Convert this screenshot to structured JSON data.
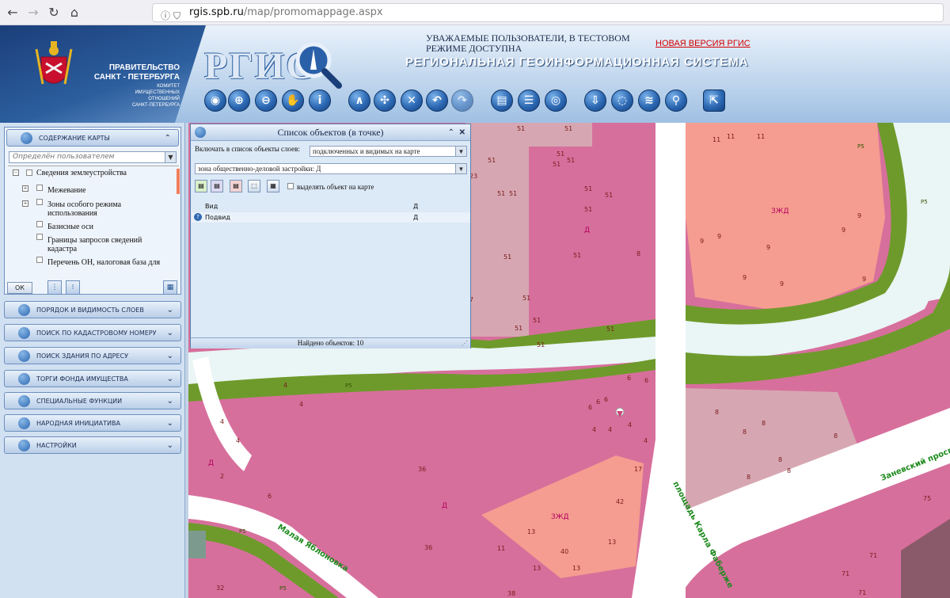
{
  "browser": {
    "url_host": "rgis.spb.ru",
    "url_path": "/map/promomappage.aspx"
  },
  "header": {
    "govt_line1": "ПРАВИТЕЛЬСТВО",
    "govt_line2": "САНКТ - ПЕТЕРБУРГА",
    "committee": [
      "КОМИТЕТ",
      "ИМУЩЕСТВЕННЫХ",
      "ОТНОШЕНИЙ",
      "САНКТ-ПЕТЕРБУРГА"
    ],
    "logo_text": "РГИС",
    "notice": "УВАЖАЕМЫЕ ПОЛЬЗОВАТЕЛИ, В ТЕСТОВОМ РЕЖИМЕ ДОСТУПНА",
    "new_version_link": "НОВАЯ ВЕРСИЯ РГИС",
    "system_title": "РЕГИОНАЛЬНАЯ  ГЕОИНФОРМАЦИОННАЯ СИСТЕМА",
    "toolbar_icons": [
      "globe-icon",
      "zoom-in-icon",
      "zoom-out-icon",
      "pan-hand-icon",
      "info-icon",
      "measure-compass-icon",
      "center-icon",
      "clear-icon",
      "back-icon",
      "forward-icon",
      "print-icon",
      "list-icon",
      "globe-refresh-icon",
      "download-icon",
      "comment-icon",
      "rss-icon",
      "location-pin-icon",
      "export-icon"
    ]
  },
  "sidebar": {
    "content_panel": {
      "title": "СОДЕРЖАНИЕ КАРТЫ",
      "user_select": "Определён пользователем",
      "tree": [
        {
          "label": "Сведения землеустройства",
          "level": 0,
          "expander": "−"
        },
        {
          "label": "Межевание",
          "level": 1,
          "expander": "+"
        },
        {
          "label": "Зоны особого режима использования",
          "level": 1,
          "expander": "+"
        },
        {
          "label": "Базисные оси",
          "level": 1,
          "expander": ""
        },
        {
          "label": "Границы запросов сведений кадастра",
          "level": 1,
          "expander": ""
        },
        {
          "label": "Перечень ОН, налоговая база для которых - кадастровая стоимость",
          "level": 1,
          "expander": ""
        }
      ],
      "ok_label": "ОК"
    },
    "panels": [
      {
        "title": "ПОРЯДОК И ВИДИМОСТЬ СЛОЕВ",
        "icon": "layers-icon"
      },
      {
        "title": "ПОИСК ПО КАДАСТРОВОМУ НОМЕРУ",
        "icon": "search-cadastre-icon"
      },
      {
        "title": "ПОИСК ЗДАНИЯ ПО АДРЕСУ",
        "icon": "search-building-icon"
      },
      {
        "title": "ТОРГИ ФОНДА ИМУЩЕСТВА",
        "icon": "auction-hammer-icon"
      },
      {
        "title": "СПЕЦИАЛЬНЫЕ ФУНКЦИИ",
        "icon": "gear-icon"
      },
      {
        "title": "НАРОДНАЯ ИНИЦИАТИВА",
        "icon": "megaphone-icon"
      },
      {
        "title": "НАСТРОЙКИ",
        "icon": "tools-icon"
      }
    ]
  },
  "popup": {
    "title": "Список объектов (в точке)",
    "include_label": "Включать в список объекты слоев:",
    "include_value": "подключенных и видимых на карте",
    "layer_value": "зона общественно-деловой застройки: Д",
    "highlight_label": "выделять объект на карте",
    "columns": [
      "Вид",
      "Д"
    ],
    "rows": [
      {
        "name": "Подвид",
        "value": "Д"
      }
    ],
    "status": "Найдено объектов: 10"
  },
  "map": {
    "labels": [
      {
        "text": "ЗЖД"
      },
      {
        "text": "Д"
      },
      {
        "text": "Д"
      },
      {
        "text": "Д"
      },
      {
        "text": "ЗЖД"
      },
      {
        "text": "Р5"
      },
      {
        "text": "Р5"
      },
      {
        "text": "Р5"
      },
      {
        "text": "Р5"
      },
      {
        "text": "Р5"
      }
    ],
    "street_names": [
      "Малая Яблоновка",
      "площадь Карла Фаберже",
      "Заневский проспект"
    ],
    "parcel_numbers": [
      "51",
      "51",
      "51",
      "51",
      "51",
      "51",
      "51",
      "51",
      "51",
      "51",
      "51",
      "51",
      "51",
      "51",
      "51",
      "51",
      "51",
      "23",
      "7",
      "7",
      "8",
      "11",
      "11",
      "11",
      "9",
      "9",
      "9",
      "9",
      "9",
      "9",
      "9",
      "9",
      "4",
      "4",
      "4",
      "4",
      "4",
      "4",
      "4",
      "4",
      "6",
      "6",
      "6",
      "6",
      "6",
      "6",
      "2",
      "36",
      "36",
      "13",
      "13",
      "13",
      "40",
      "42",
      "17",
      "11",
      "8",
      "8",
      "8",
      "8",
      "8",
      "8",
      "8",
      "75",
      "71",
      "71",
      "71",
      "32",
      "38"
    ]
  },
  "colors": {
    "header_dark": "#1b3f7a",
    "panel_bg": "#d2e1f2",
    "zone_public": "#d76f9c",
    "zone_pink_light": "#d6a7b2",
    "zone_residential": "#f59d90",
    "park_green": "#6e9a2c",
    "road_light": "#eaf5f5",
    "link_red": "#d20000"
  }
}
